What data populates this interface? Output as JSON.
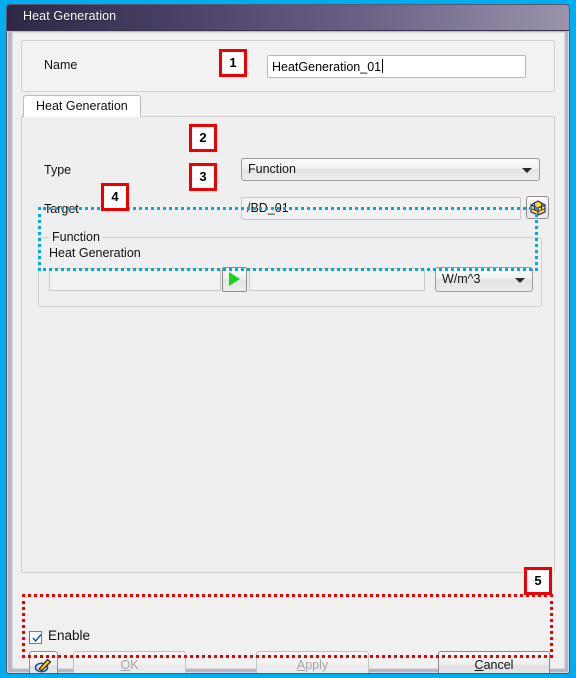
{
  "window": {
    "title": "Heat Generation"
  },
  "name_panel": {
    "label": "Name",
    "value": "HeatGeneration_01",
    "has_caret": true
  },
  "tabs": [
    {
      "label": "Heat Generation",
      "selected": true
    }
  ],
  "form": {
    "type_row": {
      "label": "Type",
      "value": "Function",
      "control": "combobox"
    },
    "target_row": {
      "label": "Target",
      "value": "/BD_01",
      "control": "textbox",
      "picker_icon": "mesh-cube-icon"
    },
    "function_group": {
      "title": "Function",
      "field_label": "Heat Generation",
      "expression_value": "",
      "result_value": "",
      "play_icon": "play-icon",
      "unit": "W/m^3",
      "unit_control": "combobox"
    }
  },
  "footer": {
    "enable": {
      "label": "Enable",
      "checked": true
    },
    "buttons": [
      {
        "name": "brush",
        "label": "",
        "icon": "paint-brush-icon",
        "enabled": true
      },
      {
        "name": "ok",
        "label": "OK",
        "accel": "O",
        "enabled": false
      },
      {
        "name": "apply",
        "label": "Apply",
        "accel": "A",
        "enabled": false
      },
      {
        "name": "cancel",
        "label": "Cancel",
        "accel": "C",
        "enabled": true
      }
    ]
  },
  "annotations": {
    "badges": [
      {
        "number": "1",
        "target": "name-input"
      },
      {
        "number": "2",
        "target": "type-combobox"
      },
      {
        "number": "3",
        "target": "target-textbox"
      },
      {
        "number": "4",
        "target": "function-group"
      },
      {
        "number": "5",
        "target": "footer-region"
      }
    ],
    "highlight_colors": {
      "cyan": "#00a8e8",
      "red": "#ee0000",
      "outer_frame": "#00aeef"
    }
  }
}
